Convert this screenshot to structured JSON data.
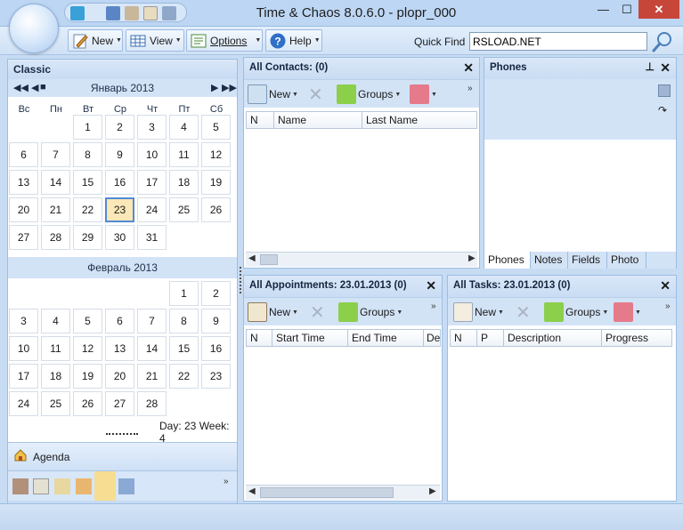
{
  "window": {
    "title": "Time & Chaos 8.0.6.0 - plopr_000",
    "min_glyph": "—",
    "max_glyph": "☐",
    "close_glyph": "✕"
  },
  "toolbar": {
    "new_label": "New",
    "view_label": "View",
    "options_label": "Options",
    "help_label": "Help",
    "quickfind_label": "Quick Find",
    "quickfind_value": "RSLOAD.NET"
  },
  "calendar": {
    "pane_title": "Classic",
    "month1": "Январь 2013",
    "month2": "Февраль 2013",
    "weekdays": [
      "Вс",
      "Пн",
      "Вт",
      "Ср",
      "Чт",
      "Пт",
      "Сб"
    ],
    "jan_weeks": [
      [
        "",
        "",
        "1",
        "2",
        "3",
        "4",
        "5"
      ],
      [
        "6",
        "7",
        "8",
        "9",
        "10",
        "11",
        "12"
      ],
      [
        "13",
        "14",
        "15",
        "16",
        "17",
        "18",
        "19"
      ],
      [
        "20",
        "21",
        "22",
        "23",
        "24",
        "25",
        "26"
      ],
      [
        "27",
        "28",
        "29",
        "30",
        "31",
        "",
        ""
      ]
    ],
    "feb_weeks": [
      [
        "",
        "",
        "",
        "",
        "",
        "1",
        "2"
      ],
      [
        "3",
        "4",
        "5",
        "6",
        "7",
        "8",
        "9"
      ],
      [
        "10",
        "11",
        "12",
        "13",
        "14",
        "15",
        "16"
      ],
      [
        "17",
        "18",
        "19",
        "20",
        "21",
        "22",
        "23"
      ],
      [
        "24",
        "25",
        "26",
        "27",
        "28",
        "",
        ""
      ]
    ],
    "selected_day": "23",
    "day_week": "Day: 23  Week: 4",
    "agenda_label": "Agenda"
  },
  "contacts": {
    "title": "All Contacts:  (0)",
    "new_label": "New",
    "groups_label": "Groups",
    "columns": [
      "N",
      "Name",
      "Last Name"
    ]
  },
  "phones": {
    "title": "Phones",
    "tabs": [
      "Phones",
      "Notes",
      "Fields",
      "Photo"
    ]
  },
  "appointments": {
    "title": "All Appointments: 23.01.2013  (0)",
    "new_label": "New",
    "groups_label": "Groups",
    "columns": [
      "N",
      "Start Time",
      "End Time",
      "Des"
    ]
  },
  "tasks": {
    "title": "All Tasks: 23.01.2013  (0)",
    "new_label": "New",
    "groups_label": "Groups",
    "columns": [
      "N",
      "P",
      "Description",
      "Progress"
    ]
  },
  "colors": {
    "frame": "#c7dcf3",
    "panel_header": "#dae8f8",
    "today_fill": "#fbe7b7",
    "today_border": "#4f8ad6",
    "close_red": "#c7463a"
  }
}
